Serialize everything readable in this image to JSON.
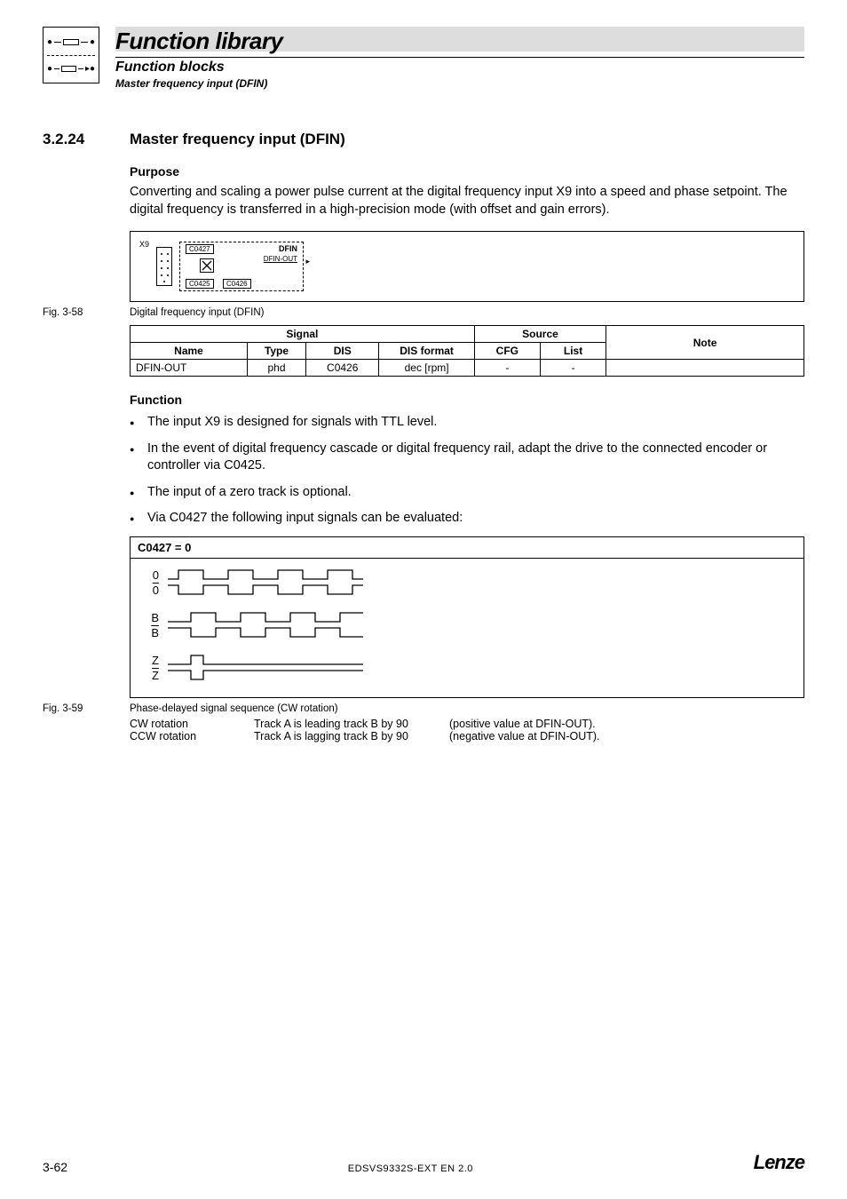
{
  "header": {
    "title": "Function library",
    "sub1": "Function blocks",
    "sub2": "Master frequency input (DFIN)"
  },
  "section": {
    "number": "3.2.24",
    "title": "Master frequency input (DFIN)"
  },
  "purpose": {
    "heading": "Purpose",
    "text": "Converting and scaling a power pulse current at the digital frequency input X9 into a speed and phase setpoint. The digital frequency is transferred in a high-precision mode (with offset and gain errors)."
  },
  "diagram": {
    "x9": "X9",
    "c0427": "C0427",
    "dfin": "DFIN",
    "dfin_out": "DFIN-OUT",
    "c0425": "C0425",
    "c0426": "C0426"
  },
  "fig58": {
    "label": "Fig. 3-58",
    "caption": "Digital frequency input (DFIN)"
  },
  "table": {
    "hdr_signal": "Signal",
    "hdr_source": "Source",
    "hdr_note": "Note",
    "col_name": "Name",
    "col_type": "Type",
    "col_dis": "DIS",
    "col_disfmt": "DIS format",
    "col_cfg": "CFG",
    "col_list": "List",
    "rows": [
      {
        "name": "DFIN-OUT",
        "type": "phd",
        "dis": "C0426",
        "disfmt": "dec [rpm]",
        "cfg": "-",
        "list": "-",
        "note": ""
      }
    ]
  },
  "function": {
    "heading": "Function",
    "bullets": [
      "The input X9 is designed for signals with TTL level.",
      "In the event of digital frequency cascade or digital frequency rail, adapt the drive to the connected encoder or controller via C0425.",
      "The input of a zero track is optional.",
      "Via C0427 the following input signals can be evaluated:"
    ]
  },
  "chart_data": {
    "type": "table",
    "title": "C0427 = 0",
    "description": "Phase-delayed quadrature signal sequence for CW rotation",
    "tracks": [
      {
        "name": "0",
        "type": "square_wave",
        "duty": 0.5,
        "periods_shown": 4,
        "phase_deg": 0
      },
      {
        "name": "0̄",
        "type": "square_wave",
        "duty": 0.5,
        "periods_shown": 4,
        "phase_deg": 180
      },
      {
        "name": "B",
        "type": "square_wave",
        "duty": 0.5,
        "periods_shown": 4,
        "phase_deg": 90
      },
      {
        "name": "B̄",
        "type": "square_wave",
        "duty": 0.5,
        "periods_shown": 4,
        "phase_deg": 270
      },
      {
        "name": "Z",
        "type": "pulse",
        "pulses_shown": 1,
        "position": "early"
      },
      {
        "name": "Z̄",
        "type": "pulse_inverted",
        "pulses_shown": 1,
        "position": "early"
      }
    ]
  },
  "wave": {
    "heading": "C0427 = 0",
    "labels": {
      "A": "0",
      "Abar": "0",
      "B": "B",
      "Bbar": "B",
      "Z": "Z",
      "Zbar": "Z"
    }
  },
  "fig59": {
    "label": "Fig. 3-59",
    "caption": "Phase-delayed signal sequence (CW rotation)"
  },
  "rotation": {
    "rows": [
      {
        "c1": "CW rotation",
        "c2": "Track A is leading track B by 90",
        "c3": "(positive value at DFIN-OUT)."
      },
      {
        "c1": "CCW rotation",
        "c2": "Track A is lagging track B by 90",
        "c3": "(negative value at DFIN-OUT)."
      }
    ]
  },
  "footer": {
    "page": "3-62",
    "docid": "EDSVS9332S-EXT EN 2.0",
    "brand": "Lenze"
  }
}
